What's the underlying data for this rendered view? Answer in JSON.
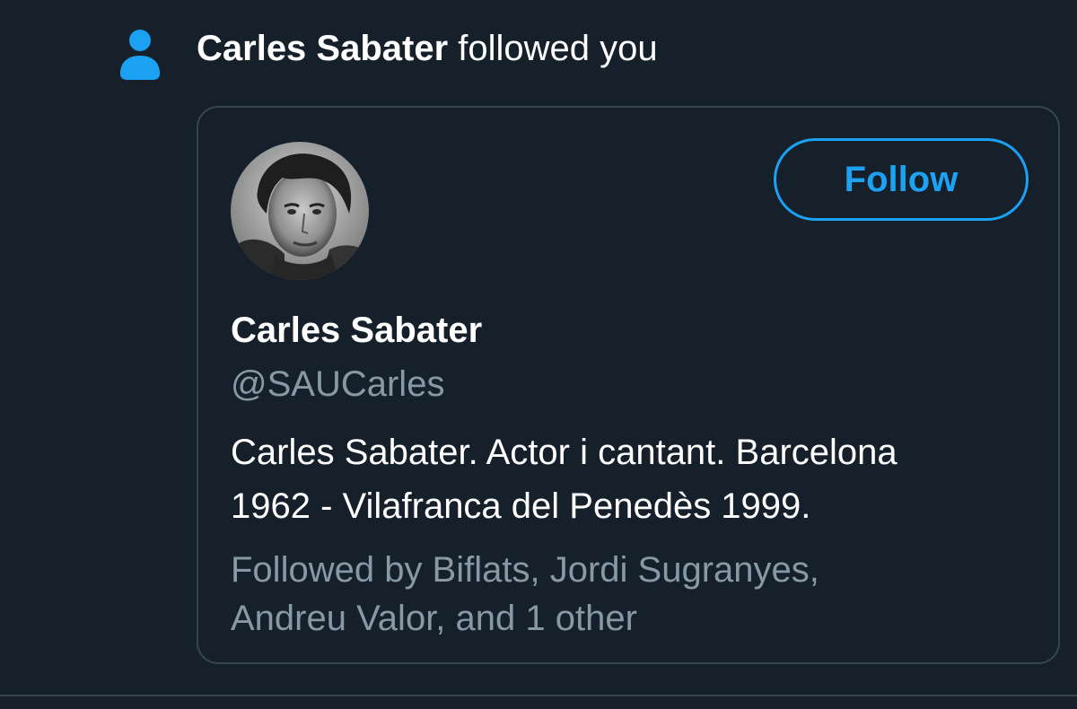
{
  "notification": {
    "actor_name": "Carles Sabater",
    "action_text": " followed you",
    "icon": "person-icon"
  },
  "profile_card": {
    "avatar": "profile-avatar",
    "display_name": "Carles Sabater",
    "handle": "@SAUCarles",
    "bio_line1": "Carles Sabater. Actor i cantant. Barcelona",
    "bio_line2": "1962 - Vilafranca del Penedès 1999.",
    "followed_by_line1": "Followed by Biflats, Jordi Sugranyes,",
    "followed_by_line2": "Andreu Valor, and 1 other",
    "follow_label": "Follow"
  },
  "colors": {
    "background": "#15202b",
    "accent": "#1da1f2",
    "border": "#38444d",
    "secondary_text": "#8899a6",
    "primary_text": "#ffffff"
  }
}
